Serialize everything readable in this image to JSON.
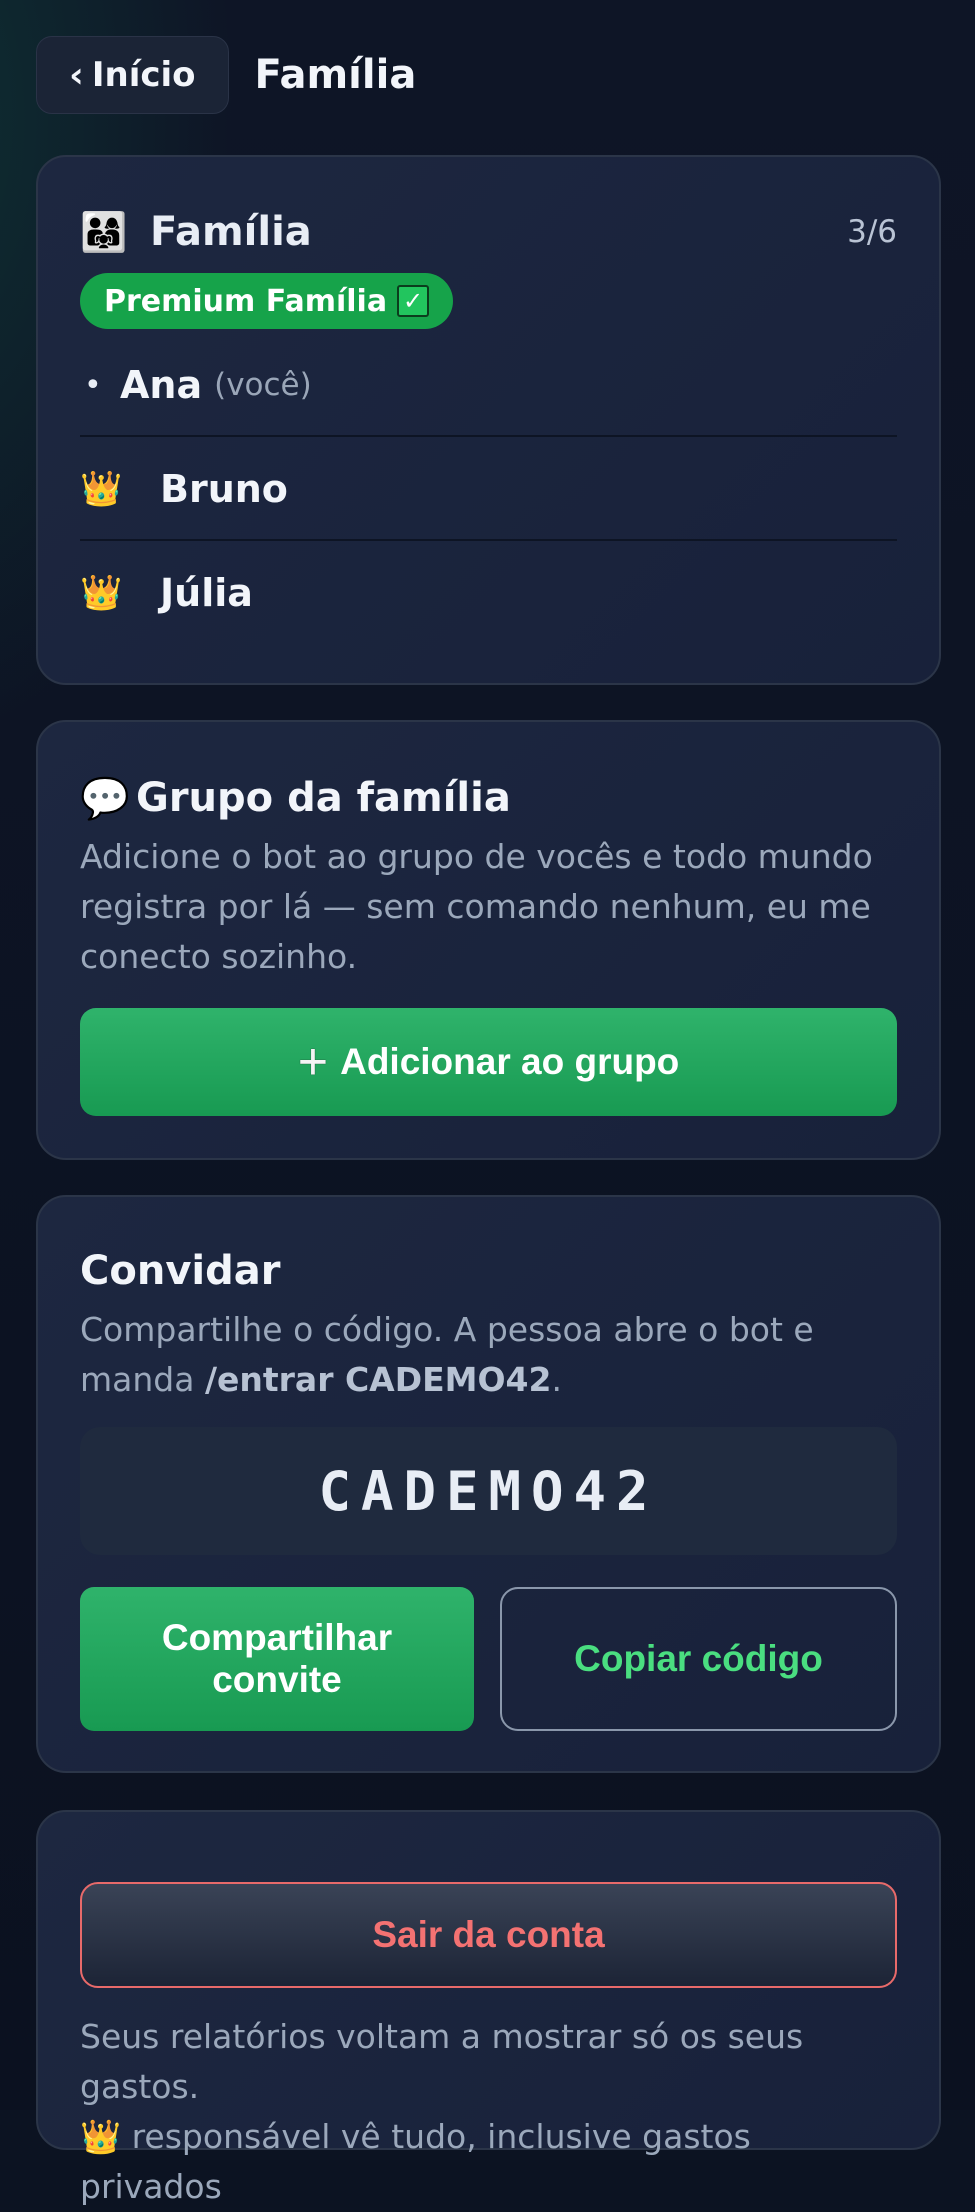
{
  "header": {
    "back_label": "Início",
    "back_chevron": "‹",
    "title": "Família"
  },
  "family": {
    "icon": "family-icon",
    "title": "Família",
    "count": "3/6",
    "plan_badge": "Premium Família",
    "plan_check": "✓",
    "members": [
      {
        "name": "Ana",
        "note": "(você)",
        "marker": "•"
      },
      {
        "name": "Bruno",
        "marker_icon": "crown-icon"
      },
      {
        "name": "Júlia",
        "marker_icon": "crown-icon"
      }
    ]
  },
  "group": {
    "icon": "speech-bubble-icon",
    "title": "Grupo da família",
    "description": "Adicione o bot ao grupo de vocês e todo mundo registra por lá — sem comando nenhum, eu me conecto sozinho.",
    "add_button": "Adicionar ao grupo",
    "add_button_icon": "plus-icon"
  },
  "invite": {
    "title": "Convidar",
    "description_prefix": "Compartilhe o código. A pessoa abre o bot e manda ",
    "command": "/entrar CADEMO42",
    "description_suffix": ".",
    "code": "CADEMO42",
    "share_button": "Compartilhar convite",
    "copy_button": "Copiar código"
  },
  "logout": {
    "button": "Sair da conta",
    "note_line1": "Seus relatórios voltam a mostrar só os seus gastos.",
    "note_line2": "responsável vê tudo, inclusive gastos privados"
  },
  "colors": {
    "accent_green": "#16a34a",
    "link_green": "#4ade80",
    "danger_red": "#f47272",
    "card_bg": "#1d2740"
  }
}
